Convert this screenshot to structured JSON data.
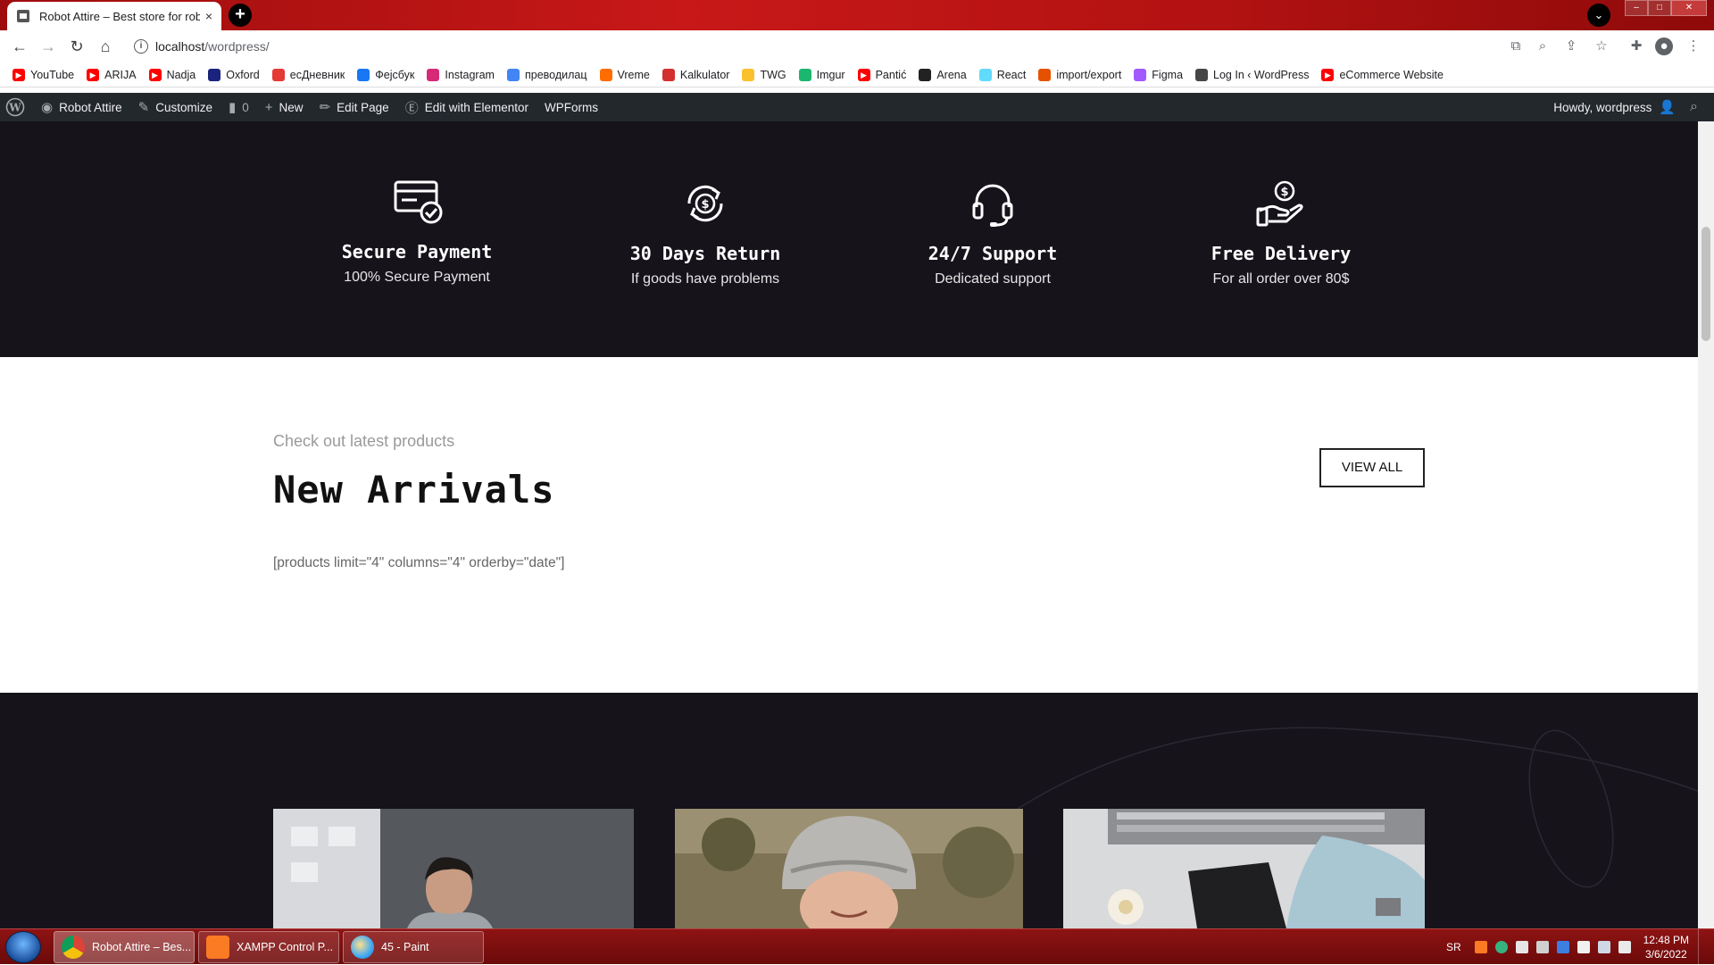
{
  "browser": {
    "tab_title": "Robot Attire – Best store for robo",
    "tab_close": "×",
    "new_tab": "+",
    "url_host": "localhost",
    "url_path": "/wordpress/"
  },
  "bookmarks": [
    {
      "label": "YouTube",
      "icon": "youtube-icon",
      "color": "#ff0000"
    },
    {
      "label": "ARIJA",
      "icon": "youtube-icon",
      "color": "#ff0000"
    },
    {
      "label": "Nadja",
      "icon": "youtube-icon",
      "color": "#ff0000"
    },
    {
      "label": "Oxford",
      "icon": "oxford-icon",
      "color": "#1a237e"
    },
    {
      "label": "есДневник",
      "icon": "diary-icon",
      "color": "#e53935"
    },
    {
      "label": "Фејсбук",
      "icon": "facebook-icon",
      "color": "#1877f2"
    },
    {
      "label": "Instagram",
      "icon": "instagram-icon",
      "color": "#d62976"
    },
    {
      "label": "преводилац",
      "icon": "translate-icon",
      "color": "#4285f4"
    },
    {
      "label": "Vreme",
      "icon": "weather-icon",
      "color": "#ff6d00"
    },
    {
      "label": "Kalkulator",
      "icon": "calculator-icon",
      "color": "#d32f2f"
    },
    {
      "label": "TWG",
      "icon": "twg-icon",
      "color": "#fbc02d"
    },
    {
      "label": "Imgur",
      "icon": "imgur-icon",
      "color": "#1bb76e"
    },
    {
      "label": "Pantić",
      "icon": "youtube-icon",
      "color": "#ff0000"
    },
    {
      "label": "Arena",
      "icon": "arena-icon",
      "color": "#222222"
    },
    {
      "label": "React",
      "icon": "react-icon",
      "color": "#61dafb"
    },
    {
      "label": "import/export",
      "icon": "import-icon",
      "color": "#e65100"
    },
    {
      "label": "Figma",
      "icon": "figma-icon",
      "color": "#a259ff"
    },
    {
      "label": "Log In ‹ WordPress",
      "icon": "wordpress-icon",
      "color": "#464646"
    },
    {
      "label": "eCommerce Website",
      "icon": "youtube-icon",
      "color": "#ff0000"
    }
  ],
  "adminbar": {
    "site_name": "Robot Attire",
    "customize": "Customize",
    "comments_count": "0",
    "new": "New",
    "edit_page": "Edit Page",
    "edit_elementor": "Edit with Elementor",
    "wpforms": "WPForms",
    "howdy": "Howdy, wordpress"
  },
  "features": [
    {
      "title": "Secure Payment",
      "subtitle": "100% Secure Payment",
      "icon": "card-check-icon"
    },
    {
      "title": "30 Days Return",
      "subtitle": "If goods have problems",
      "icon": "money-return-icon"
    },
    {
      "title": "24/7 Support",
      "subtitle": "Dedicated support",
      "icon": "headset-icon"
    },
    {
      "title": "Free Delivery",
      "subtitle": "For all order over 80$",
      "icon": "hand-money-icon"
    }
  ],
  "arrivals": {
    "subtitle": "Check out latest products",
    "title": "New Arrivals",
    "button": "VIEW ALL",
    "shortcode": "[products limit=\"4\" columns=\"4\" orderby=\"date\"]"
  },
  "taskbar": {
    "tasks": [
      {
        "label": "Robot Attire – Bes...",
        "icon": "chrome-icon"
      },
      {
        "label": "XAMPP Control P...",
        "icon": "xampp-icon"
      },
      {
        "label": "45 - Paint",
        "icon": "paint-icon"
      }
    ],
    "lang": "SR",
    "time": "12:48 PM",
    "date": "3/6/2022"
  },
  "colors": {
    "dark_bg": "#16131b",
    "admin_bar": "#23282d",
    "chrome_frame": "#b31212"
  }
}
